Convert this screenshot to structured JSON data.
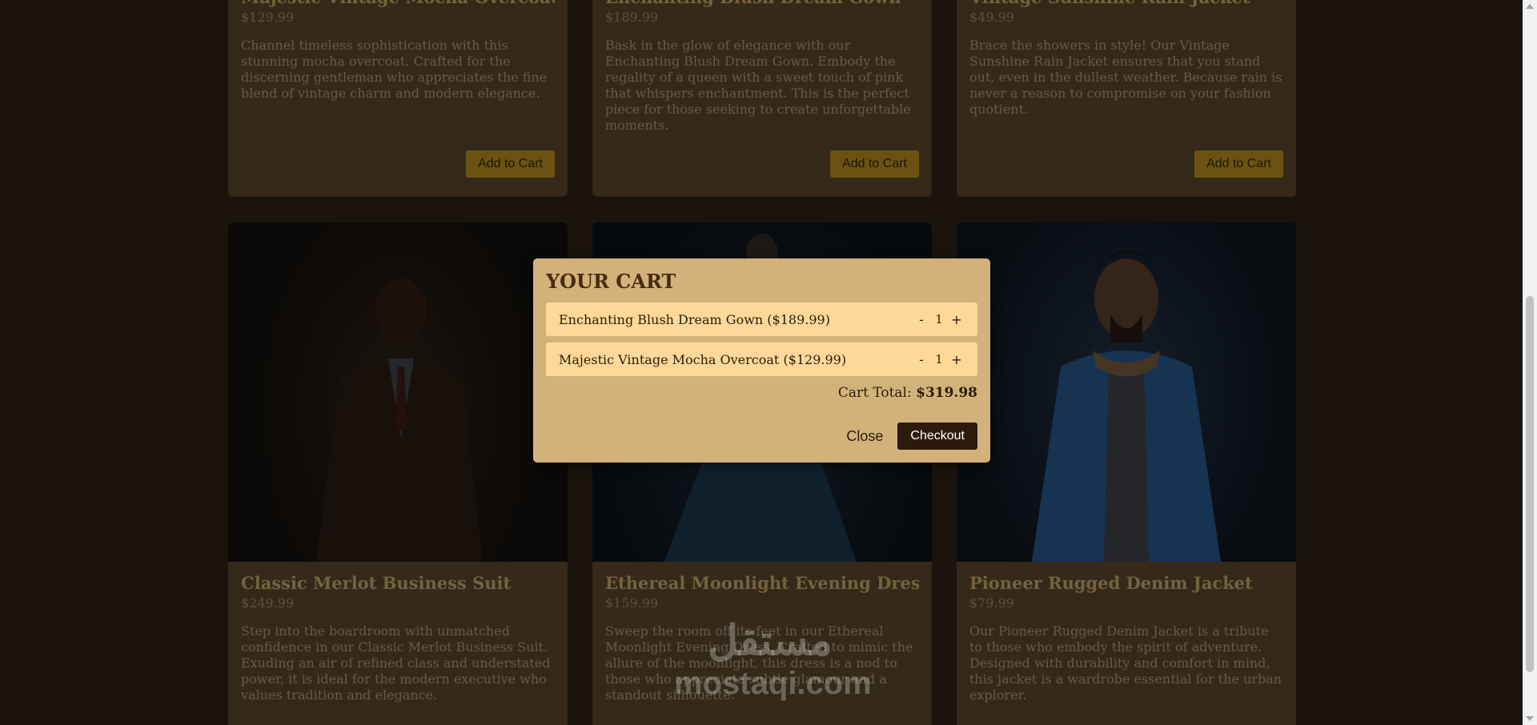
{
  "products": [
    {
      "name": "Majestic Vintage Mocha Overcoat",
      "price": "$129.99",
      "description": "Channel timeless sophistication with this stunning mocha overcoat. Crafted for the discerning gentleman who appreciates the fine blend of vintage charm and modern elegance.",
      "add_label": "Add to Cart"
    },
    {
      "name": "Enchanting Blush Dream Gown",
      "price": "$189.99",
      "description": "Bask in the glow of elegance with our Enchanting Blush Dream Gown. Embody the regality of a queen with a sweet touch of pink that whispers enchantment. This is the perfect piece for those seeking to create unforgettable moments.",
      "add_label": "Add to Cart"
    },
    {
      "name": "Vintage Sunshine Rain Jacket",
      "price": "$49.99",
      "description": "Brace the showers in style! Our Vintage Sunshine Rain Jacket ensures that you stand out, even in the dullest weather. Because rain is never a reason to compromise on your fashion quotient.",
      "add_label": "Add to Cart"
    },
    {
      "name": "Classic Merlot Business Suit",
      "price": "$249.99",
      "description": "Step into the boardroom with unmatched confidence in our Classic Merlot Business Suit. Exuding an air of refined class and understated power, it is ideal for the modern executive who values tradition and elegance."
    },
    {
      "name": "Ethereal Moonlight Evening Dress",
      "price": "$159.99",
      "description": "Sweep the room off its feet in our Ethereal Moonlight Evening Dress. Crafted to mimic the allure of the moonlight, this dress is a nod to those who appreciate subtle glamour and a standout silhouette."
    },
    {
      "name": "Pioneer Rugged Denim Jacket",
      "price": "$79.99",
      "description": "Our Pioneer Rugged Denim Jacket is a tribute to those who embody the spirit of adventure. Designed with durability and comfort in mind, this jacket is a wardrobe essential for the urban explorer."
    }
  ],
  "cart": {
    "title": "YOUR CART",
    "items": [
      {
        "label": "Enchanting Blush Dream Gown ($189.99)",
        "qty": "1",
        "minus": "-",
        "plus": "+"
      },
      {
        "label": "Majestic Vintage Mocha Overcoat ($129.99)",
        "qty": "1",
        "minus": "-",
        "plus": "+"
      }
    ],
    "total_label": "Cart Total:",
    "total_value": "$319.98",
    "close_label": "Close",
    "checkout_label": "Checkout"
  },
  "watermark": {
    "arabic": "مستقل",
    "latin": "mostaqi.com"
  },
  "colors": {
    "accent_button": "#d8a424",
    "modal_bg": "#d2b27a",
    "cart_item_bg": "#fed898",
    "checkout_bg": "#2c1a0a",
    "title_gold": "#e8c47f"
  }
}
